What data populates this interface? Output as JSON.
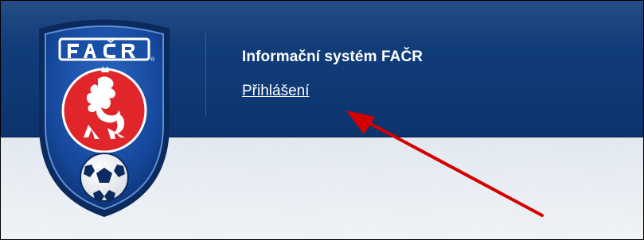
{
  "header": {
    "title": "Informační systém FAČR",
    "login_link": "Přihlášení"
  },
  "logo": {
    "text": "FAČR",
    "icon": "facr-crest-logo"
  },
  "annotation": {
    "icon": "red-arrow-icon",
    "color": "#d40000"
  },
  "colors": {
    "header": "#123e7c",
    "crest_red": "#e0262b",
    "content_bg": "#e9edf2"
  }
}
